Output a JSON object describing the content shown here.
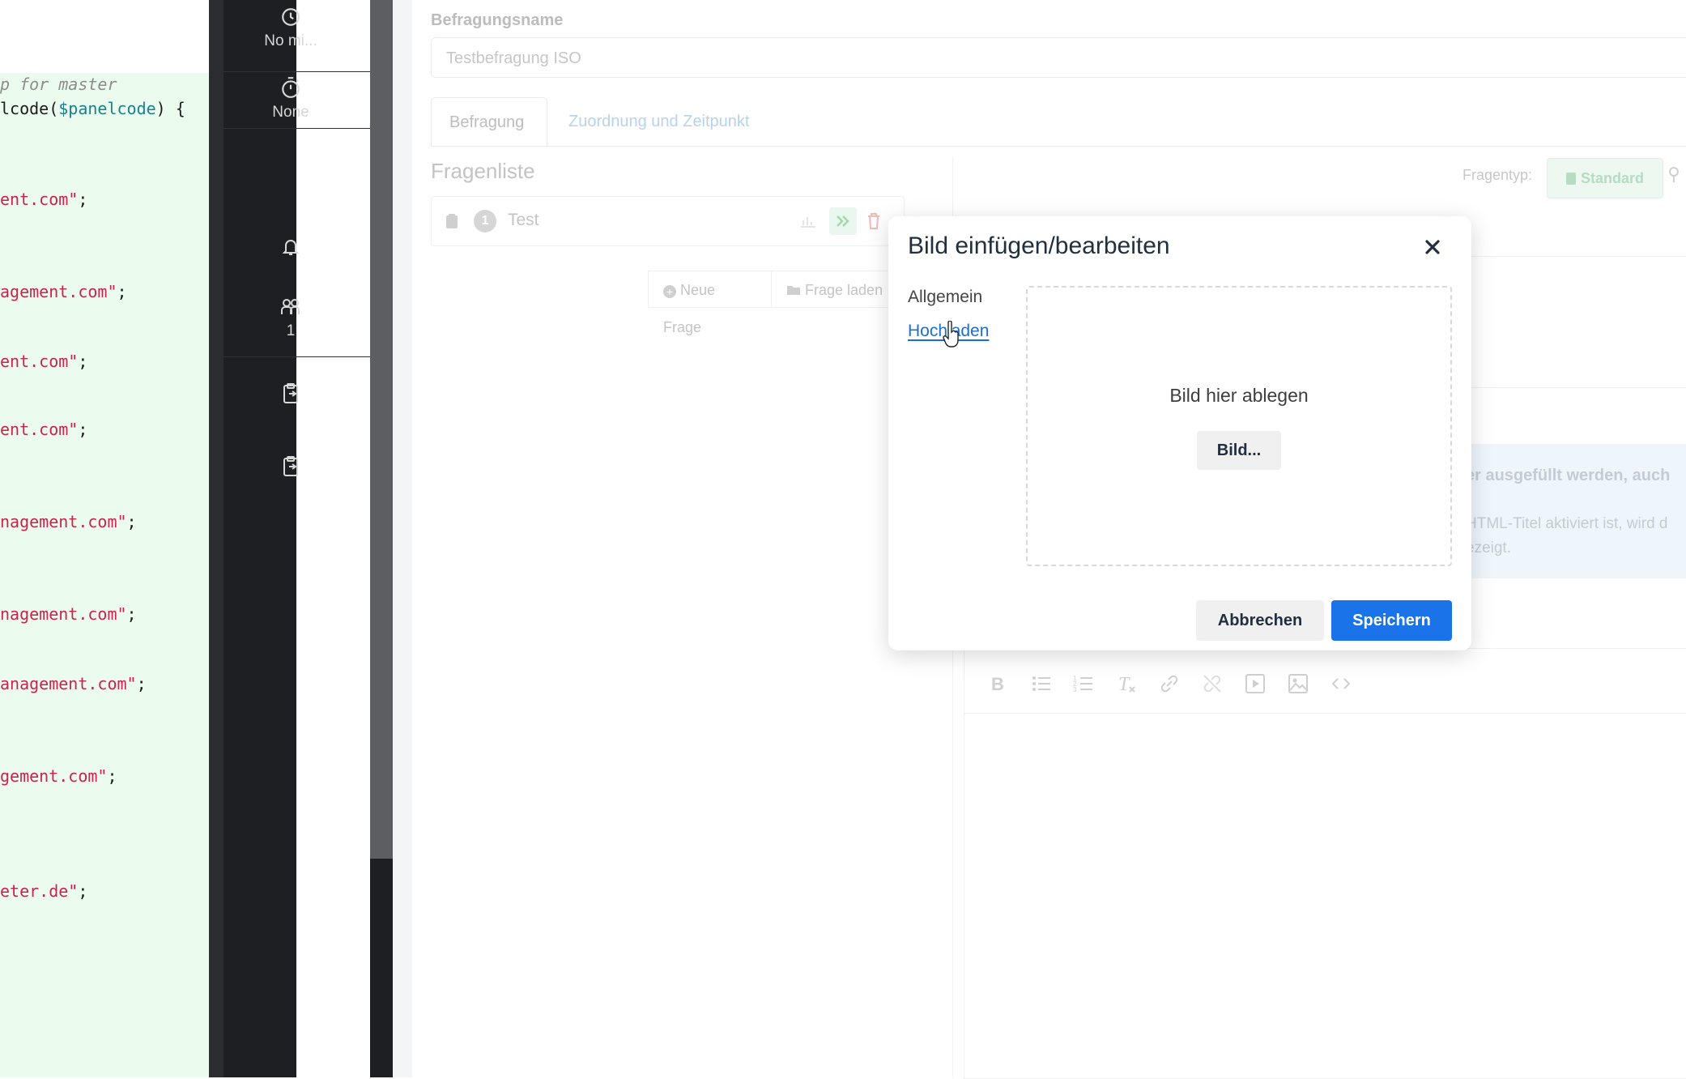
{
  "code_editor": {
    "lines": [
      {
        "text": "p for master",
        "kind": "comment"
      },
      {
        "pre": "lcode(",
        "var": "$panelcode",
        "post": ") {",
        "kind": "mixed"
      },
      {
        "str": "ent.com\"",
        "post": ";",
        "kind": "string"
      },
      {
        "str": "agement.com\"",
        "post": ";",
        "kind": "string"
      },
      {
        "str": "ent.com\"",
        "post": ";",
        "kind": "string"
      },
      {
        "str": "ent.com\"",
        "post": ";",
        "kind": "string"
      },
      {
        "str": "nagement.com\"",
        "post": ";",
        "kind": "string"
      },
      {
        "str": "nagement.com\"",
        "post": ";",
        "kind": "string"
      },
      {
        "str": "anagement.com\"",
        "post": ";",
        "kind": "string"
      },
      {
        "str": "gement.com\"",
        "post": ";",
        "kind": "string"
      },
      {
        "str": "eter.de\"",
        "post": ";",
        "kind": "string"
      }
    ]
  },
  "sidebar": {
    "timer1_label": "No mi...",
    "timer2_label": "None",
    "users_count": "1"
  },
  "app": {
    "survey_name_label": "Befragungsname",
    "survey_name_value": "Testbefragung ISO",
    "tabs": [
      "Befragung",
      "Zuordnung und Zeitpunkt"
    ],
    "question_list_title": "Fragenliste",
    "question": {
      "number": "1",
      "title": "Test"
    },
    "new_question_label": "Neue Frage",
    "load_question_label": "Frage laden",
    "question_type_label": "Fragentyp:",
    "question_type_value": "Standard",
    "info_bold": "er ausgefüllt werden, auch",
    "info_line2": "HTML-Titel aktiviert ist, wird d",
    "info_line3": "ezeigt."
  },
  "modal": {
    "title": "Bild einfügen/bearbeiten",
    "nav_general": "Allgemein",
    "nav_upload": "Hochladen",
    "drop_text": "Bild hier ablegen",
    "browse_label": "Bild...",
    "cancel_label": "Abbrechen",
    "save_label": "Speichern"
  },
  "colors": {
    "primary": "#1a73e8",
    "code_bg": "#ebfbed",
    "sidebar_bg": "#1e1f22"
  }
}
